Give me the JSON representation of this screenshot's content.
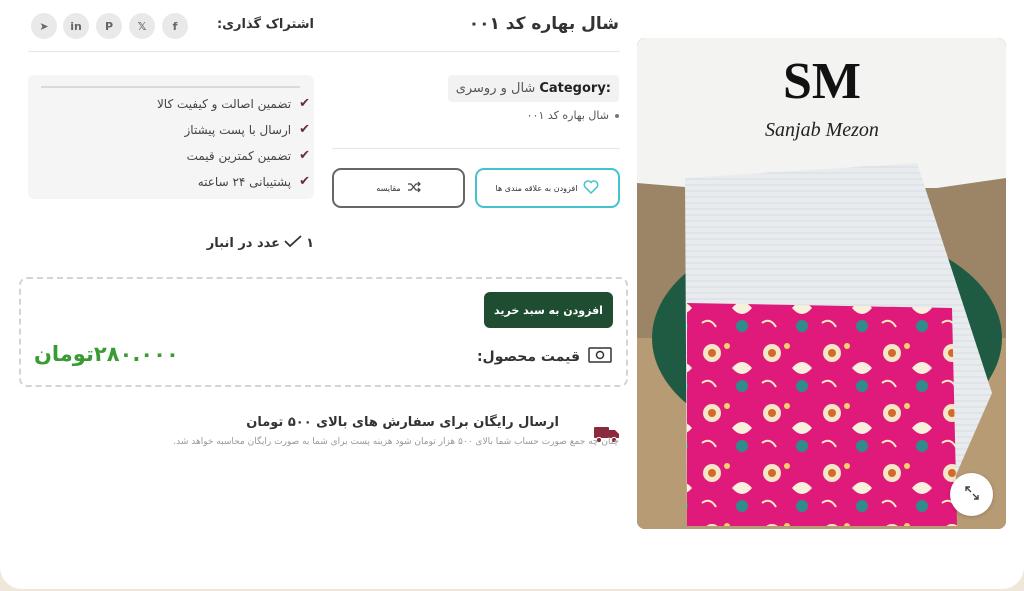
{
  "product": {
    "title": "شال بهاره کد ۰۰۱",
    "category_key": "Category:",
    "category_value": "شال و روسری",
    "short_description": "شال بهاره کد ۰۰۱",
    "image_logo_text": "Sanjab Mezon"
  },
  "share": {
    "label": "اشتراک گذاری:",
    "networks": [
      "facebook-icon",
      "x-icon",
      "pinterest-icon",
      "linkedin-icon",
      "telegram-icon"
    ]
  },
  "actions": {
    "wishlist_label": "افزودن به علاقه مندی ها",
    "compare_label": "مقایسه",
    "add_to_cart_label": "افزودن به سبد خرید"
  },
  "features": [
    "تضمین اصالت و کیفیت کالا",
    "ارسال با پست پیشتاز",
    "تضمین کمترین قیمت",
    "پشتیبانی ۲۴ ساعته"
  ],
  "stock": {
    "count": "۱",
    "label": "عدد در انبار"
  },
  "price": {
    "label": "قیمت محصول:",
    "value": "۲۸۰.۰۰۰تومان"
  },
  "shipping": {
    "title": "ارسال رایگان برای سفارش های بالای ۵۰۰ تومان",
    "description": "چنان چه جمع صورت حساب شما بالای ۵۰۰ هزار تومان شود هزینه پست برای شما به صورت رایگان محاسبه خواهد شد."
  },
  "colors": {
    "accent_green": "#1e4d32",
    "price_green": "#3a9a33",
    "wishlist_border": "#43c3cf",
    "check": "#6b2b3a"
  }
}
